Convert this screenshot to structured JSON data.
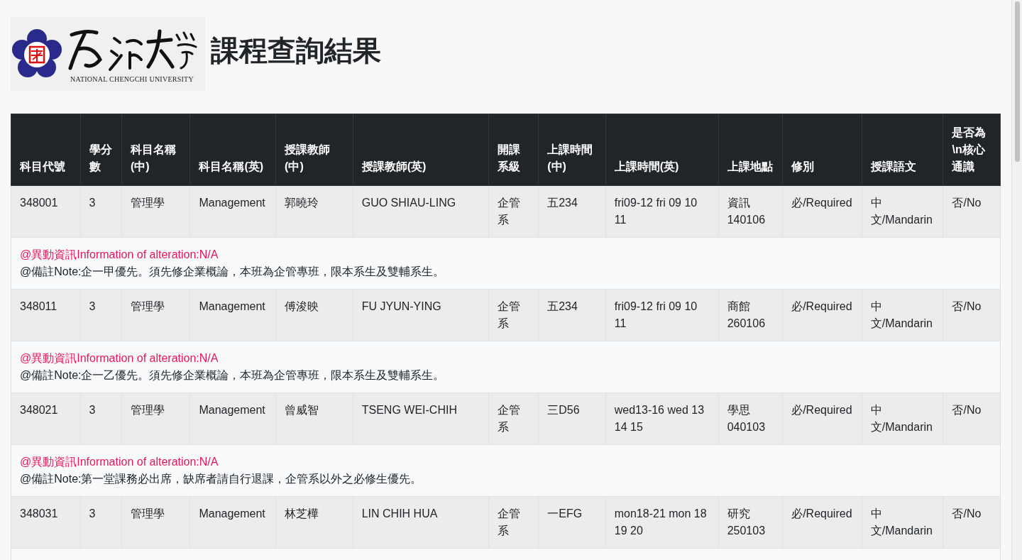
{
  "header": {
    "university_en": "NATIONAL CHENGCHI UNIVERSITY",
    "title": "課程查詢結果"
  },
  "table": {
    "columns": [
      "科目代號",
      "學分數",
      "科目名稱(中)",
      "科目名稱(英)",
      "授課教師(中)",
      "授課教師(英)",
      "開課系級",
      "上課時間(中)",
      "上課時間(英)",
      "上課地點",
      "修別",
      "授課語文",
      "是否為\\n核心通識"
    ],
    "rows": [
      {
        "cells": [
          "348001",
          "3",
          "管理學",
          "Management",
          "郭曉玲",
          "GUO SHIAU-LING",
          "企管系",
          "五234",
          "fri09-12 fri 09 10 11",
          "資訊 140106",
          "必/Required",
          "中文/Mandarin",
          "否/No"
        ],
        "alteration": "@異動資訊Information of alteration:N/A",
        "note": "@備註Note:企一甲優先。須先修企業概論，本班為企管專班，限本系生及雙輔系生。"
      },
      {
        "cells": [
          "348011",
          "3",
          "管理學",
          "Management",
          "傅浚映",
          "FU JYUN-YING",
          "企管系",
          "五234",
          "fri09-12 fri 09 10 11",
          "商館 260106",
          "必/Required",
          "中文/Mandarin",
          "否/No"
        ],
        "alteration": "@異動資訊Information of alteration:N/A",
        "note": "@備註Note:企一乙優先。須先修企業概論，本班為企管專班，限本系生及雙輔系生。"
      },
      {
        "cells": [
          "348021",
          "3",
          "管理學",
          "Management",
          "曾威智",
          "TSENG WEI-CHIH",
          "企管系",
          "三D56",
          "wed13-16 wed 13 14 15",
          "學思 040103",
          "必/Required",
          "中文/Mandarin",
          "否/No"
        ],
        "alteration": "@異動資訊Information of alteration:N/A",
        "note": "@備註Note:第一堂課務必出席，缺席者請自行退課，企管系以外之必修生優先。"
      },
      {
        "cells": [
          "348031",
          "3",
          "管理學",
          "Management",
          "林芝樺",
          "LIN CHIH HUA",
          "企管系",
          "一EFG",
          "mon18-21 mon 18 19 20",
          "研究 250103",
          "必/Required",
          "中文/Mandarin",
          "否/No"
        ]
      }
    ]
  }
}
